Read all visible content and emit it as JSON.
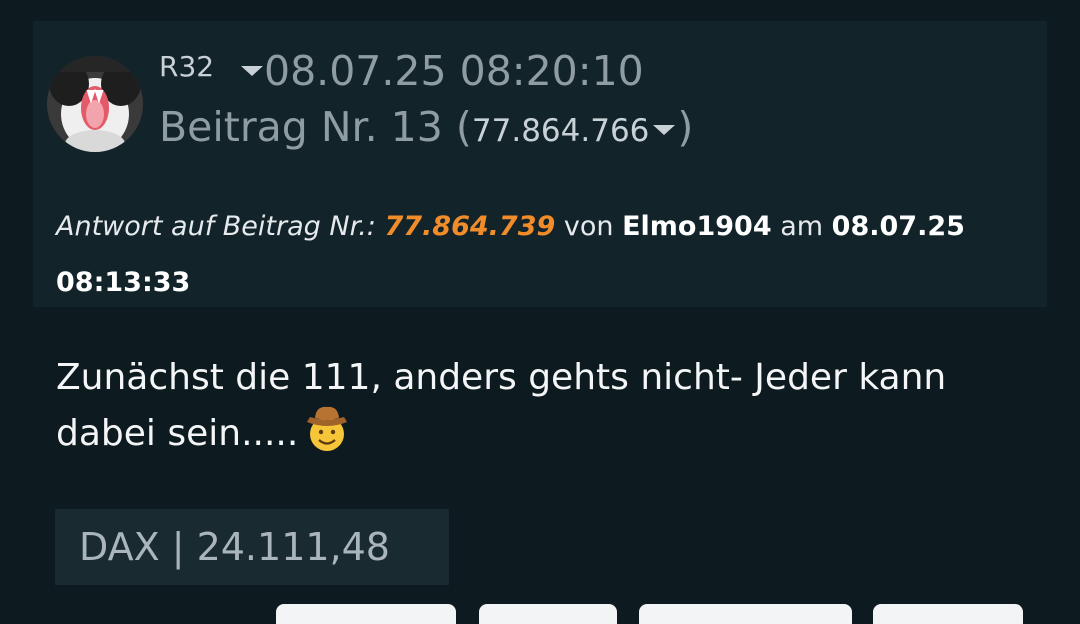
{
  "post": {
    "username": "R32",
    "timestamp": "08.07.25 08:20:10",
    "post_number_prefix": "Beitrag Nr. 13 (",
    "post_id": "77.864.766",
    "post_number_suffix": ")",
    "reply": {
      "lead": "Antwort auf Beitrag Nr.:",
      "ref_id": "77.864.739",
      "by_label": "von",
      "author": "Elmo1904",
      "at_label": "am",
      "date": "08.07.25",
      "time": "08:13:33"
    },
    "body": "Zunächst die 111, anders gehts nicht- Jeder kann dabei sein.....",
    "emoji": "cowboy-hat-face-icon",
    "ticker": "DAX | 24.111,48"
  },
  "colors": {
    "background": "#0d1b20",
    "header_background": "#13232a",
    "reference_link": "#f08c2a",
    "muted_text": "#8f9da3",
    "ticker_background": "#1a2a31"
  }
}
